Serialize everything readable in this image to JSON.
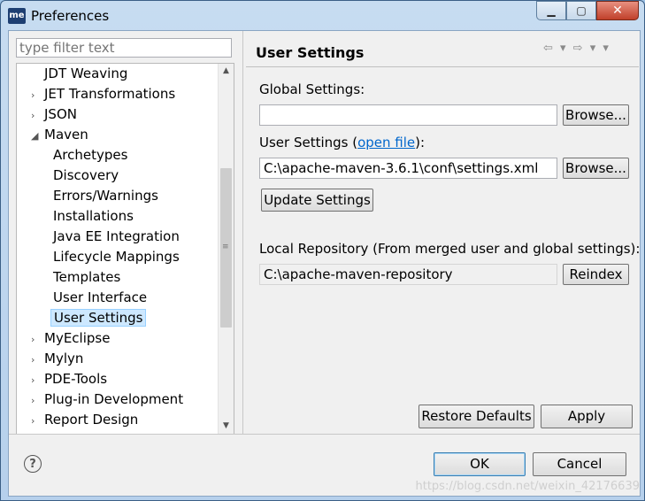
{
  "window": {
    "title": "Preferences",
    "app_icon": "me",
    "minimize": "▁",
    "maximize": "▢",
    "close": "✕"
  },
  "filter": {
    "placeholder": "type filter text"
  },
  "tree": {
    "items": [
      {
        "label": "JDT Weaving",
        "arrow": "",
        "level": 0
      },
      {
        "label": "JET Transformations",
        "arrow": "›",
        "level": 0
      },
      {
        "label": "JSON",
        "arrow": "›",
        "level": 0
      },
      {
        "label": "Maven",
        "arrow": "◢",
        "level": 0
      },
      {
        "label": "Archetypes",
        "arrow": "",
        "level": 1
      },
      {
        "label": "Discovery",
        "arrow": "",
        "level": 1
      },
      {
        "label": "Errors/Warnings",
        "arrow": "",
        "level": 1
      },
      {
        "label": "Installations",
        "arrow": "",
        "level": 1
      },
      {
        "label": "Java EE Integration",
        "arrow": "",
        "level": 1
      },
      {
        "label": "Lifecycle Mappings",
        "arrow": "",
        "level": 1
      },
      {
        "label": "Templates",
        "arrow": "",
        "level": 1
      },
      {
        "label": "User Interface",
        "arrow": "",
        "level": 1
      },
      {
        "label": "User Settings",
        "arrow": "",
        "level": 1,
        "selected": true
      },
      {
        "label": "MyEclipse",
        "arrow": "›",
        "level": 0
      },
      {
        "label": "Mylyn",
        "arrow": "›",
        "level": 0
      },
      {
        "label": "PDE-Tools",
        "arrow": "›",
        "level": 0
      },
      {
        "label": "Plug-in Development",
        "arrow": "›",
        "level": 0
      },
      {
        "label": "Report Design",
        "arrow": "›",
        "level": 0
      }
    ]
  },
  "page": {
    "title": "User Settings",
    "nav": "⇦ ▾ ⇨ ▾ ▾",
    "global_label": "Global Settings:",
    "global_value": "",
    "browse1": "Browse...",
    "user_label_prefix": "User Settings (",
    "open_file": "open file",
    "user_label_suffix": "):",
    "user_value": "C:\\apache-maven-3.6.1\\conf\\settings.xml",
    "browse2": "Browse...",
    "update": "Update Settings",
    "local_label": "Local Repository (From merged user and global settings):",
    "local_value": "C:\\apache-maven-repository",
    "reindex": "Reindex",
    "restore": "Restore Defaults",
    "apply": "Apply"
  },
  "footer": {
    "help": "?",
    "ok": "OK",
    "cancel": "Cancel",
    "watermark": "https://blog.csdn.net/weixin_42176639"
  }
}
